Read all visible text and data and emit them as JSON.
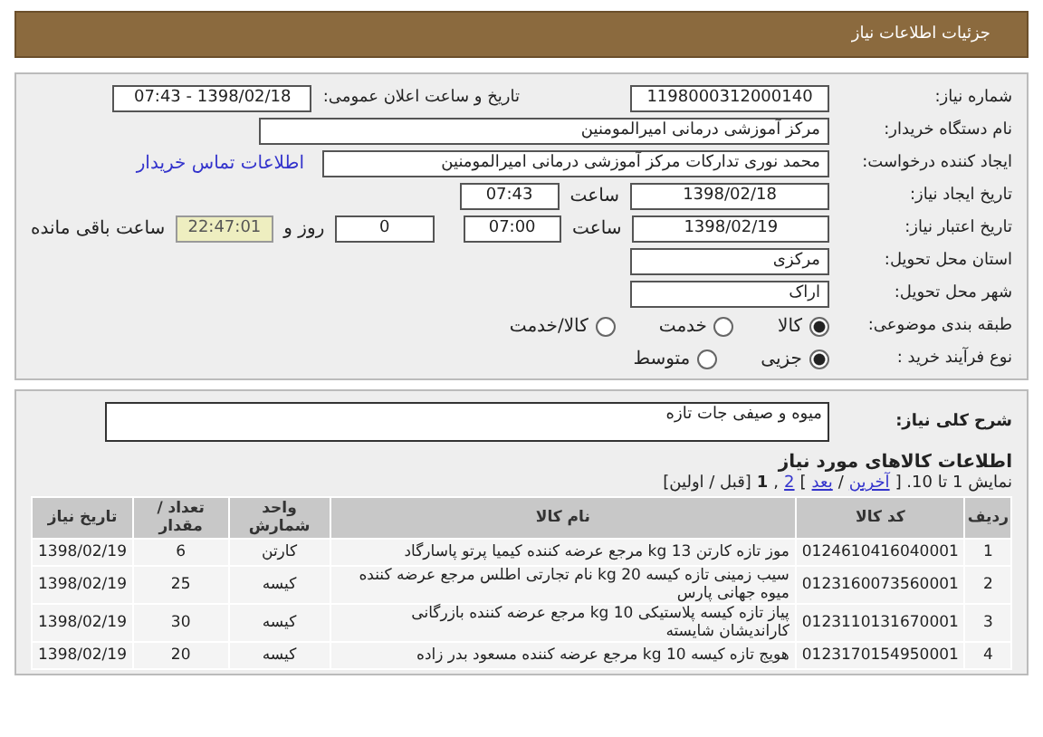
{
  "header": {
    "title": "جزئیات اطلاعات نیاز"
  },
  "need_number": {
    "label": "شماره نیاز:",
    "value": "1198000312000140"
  },
  "announce": {
    "label": "تاریخ و ساعت اعلان عمومی:",
    "value": "1398/02/18 - 07:43"
  },
  "buyer": {
    "label": "نام دستگاه خریدار:",
    "value": "مرکز آموزشی درمانی امیرالمومنین"
  },
  "creator": {
    "label": "ایجاد کننده درخواست:",
    "value": "محمد نوری تدارکات مرکز آموزشی درمانی امیرالمومنین",
    "link": "اطلاعات تماس خریدار"
  },
  "created": {
    "label": "تاریخ ایجاد نیاز:",
    "date": "1398/02/18",
    "time_label": "ساعت",
    "time": "07:43"
  },
  "validity": {
    "label": "تاریخ اعتبار نیاز:",
    "date": "1398/02/19",
    "time_label": "ساعت",
    "time": "07:00",
    "days": "0",
    "days_label": "روز و",
    "remaining": "22:47:01",
    "remaining_label": "ساعت باقی مانده"
  },
  "province": {
    "label": "استان محل تحویل:",
    "value": "مرکزی"
  },
  "city": {
    "label": "شهر محل تحویل:",
    "value": "اراک"
  },
  "category": {
    "label": "طبقه بندی موضوعی:",
    "options": [
      {
        "label": "کالا",
        "selected": true
      },
      {
        "label": "خدمت",
        "selected": false
      },
      {
        "label": "کالا/خدمت",
        "selected": false
      }
    ]
  },
  "process": {
    "label": "نوع فرآیند خرید :",
    "options": [
      {
        "label": "جزیی",
        "selected": true
      },
      {
        "label": "متوسط",
        "selected": false
      }
    ]
  },
  "description": {
    "label": "شرح کلی نیاز:",
    "value": "میوه و صیفی جات تازه"
  },
  "goods": {
    "title": "اطلاعات کالاهای مورد نیاز",
    "paging": [
      {
        "kind": "text",
        "text": "نمایش 1 تا 10. ["
      },
      {
        "kind": "link",
        "text": "آخرین"
      },
      {
        "kind": "text",
        "text": "/"
      },
      {
        "kind": "link",
        "text": "بعد"
      },
      {
        "kind": "text",
        "text": "]"
      },
      {
        "kind": "link",
        "text": "2"
      },
      {
        "kind": "text",
        "text": ","
      },
      {
        "kind": "bold",
        "text": "1"
      },
      {
        "kind": "text",
        "text": "[قبل / اولین]"
      }
    ]
  },
  "table": {
    "columns": [
      "ردیف",
      "کد کالا",
      "نام کالا",
      "واحد شمارش",
      "تعداد / مقدار",
      "تاریخ نیاز"
    ],
    "rows": [
      [
        "1",
        "0124610416040001",
        "موز تازه کارتن 13 kg مرجع عرضه کننده کیمیا پرتو پاسارگاد",
        "کارتن",
        "6",
        "1398/02/19"
      ],
      [
        "2",
        "0123160073560001",
        "سیب زمینی تازه کیسه 20 kg نام تجارتی اطلس مرجع عرضه کننده میوه جهانی پارس",
        "کیسه",
        "25",
        "1398/02/19"
      ],
      [
        "3",
        "0123110131670001",
        "پیاز تازه کیسه پلاستیکی 10 kg مرجع عرضه کننده بازرگانی کاراندیشان شایسته",
        "کیسه",
        "30",
        "1398/02/19"
      ],
      [
        "4",
        "0123170154950001",
        "هویج تازه کیسه 10 kg مرجع عرضه کننده مسعود بدر زاده",
        "کیسه",
        "20",
        "1398/02/19"
      ]
    ]
  }
}
